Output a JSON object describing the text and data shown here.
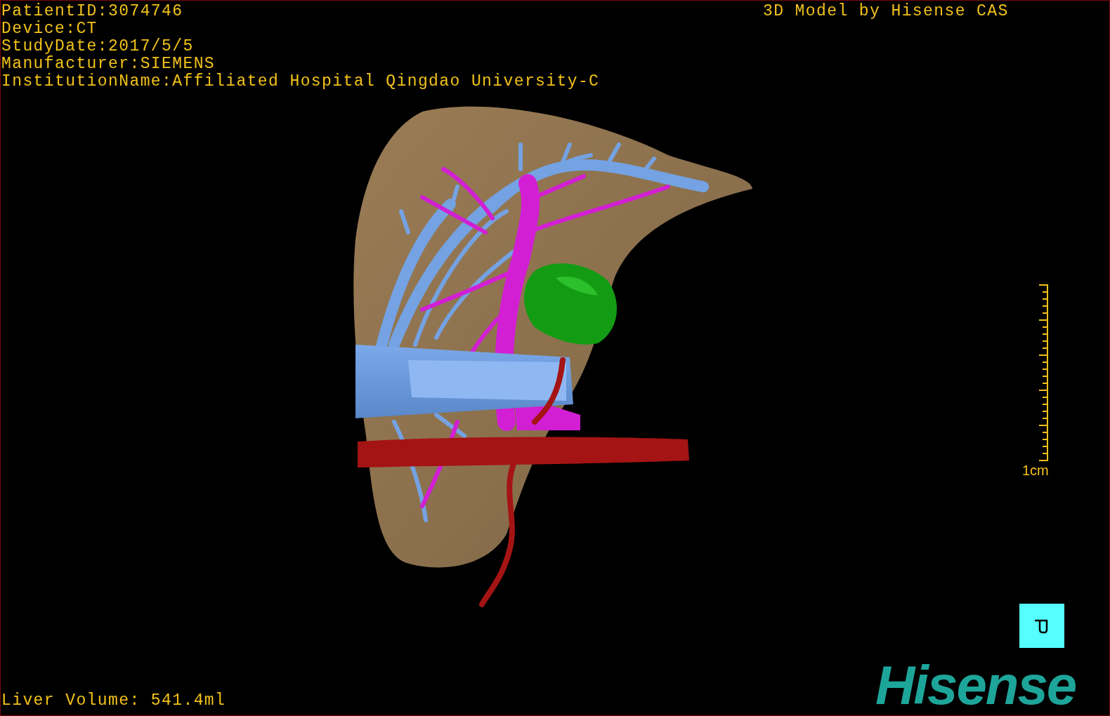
{
  "info_lines": [
    "PatientID:3074746",
    "Device:CT",
    "StudyDate:2017/5/5",
    "Manufacturer:SIEMENS",
    "InstitutionName:Affiliated Hospital Qingdao University-C"
  ],
  "title": "3D Model by Hisense CAS",
  "scale": {
    "label": "1cm"
  },
  "volume": "Liver Volume: 541.4ml",
  "logo": "Hisense"
}
